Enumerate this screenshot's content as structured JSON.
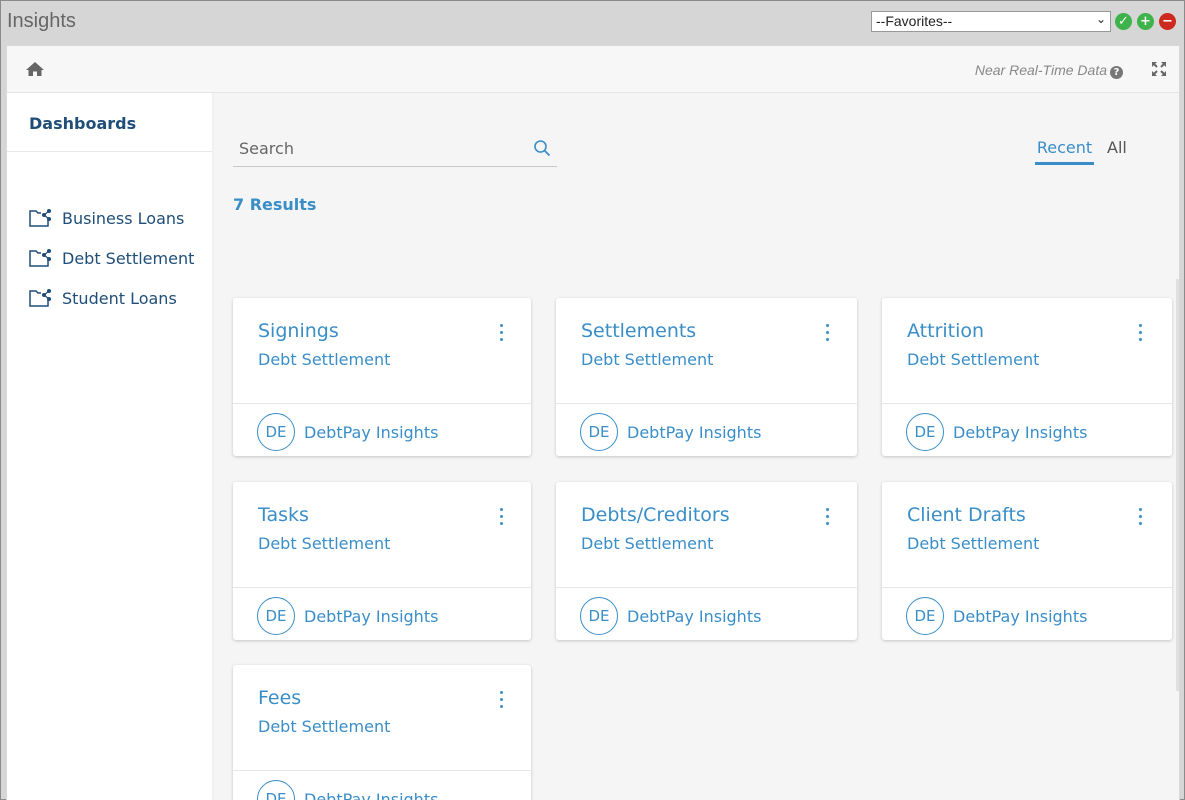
{
  "app": {
    "title": "Insights"
  },
  "favorites": {
    "selected": "--Favorites--"
  },
  "header": {
    "near_realtime": "Near Real-Time Data"
  },
  "sidebar": {
    "title": "Dashboards",
    "items": [
      {
        "label": "Business Loans"
      },
      {
        "label": "Debt Settlement"
      },
      {
        "label": "Student Loans"
      }
    ]
  },
  "search": {
    "placeholder": "Search"
  },
  "tabs": {
    "recent": "Recent",
    "all": "All"
  },
  "results": {
    "text": "7 Results"
  },
  "cards": [
    {
      "title": "Signings",
      "category": "Debt Settlement",
      "initials": "DE",
      "owner": "DebtPay Insights"
    },
    {
      "title": "Settlements",
      "category": "Debt Settlement",
      "initials": "DE",
      "owner": "DebtPay Insights"
    },
    {
      "title": "Attrition",
      "category": "Debt Settlement",
      "initials": "DE",
      "owner": "DebtPay Insights"
    },
    {
      "title": "Tasks",
      "category": "Debt Settlement",
      "initials": "DE",
      "owner": "DebtPay Insights"
    },
    {
      "title": "Debts/Creditors",
      "category": "Debt Settlement",
      "initials": "DE",
      "owner": "DebtPay Insights"
    },
    {
      "title": "Client Drafts",
      "category": "Debt Settlement",
      "initials": "DE",
      "owner": "DebtPay Insights"
    },
    {
      "title": "Fees",
      "category": "Debt Settlement",
      "initials": "DE",
      "owner": "DebtPay Insights"
    }
  ],
  "colors": {
    "accent": "#3a8ec8",
    "nav": "#1f4e79",
    "ok": "#3db34a",
    "remove": "#cc2a1e"
  }
}
